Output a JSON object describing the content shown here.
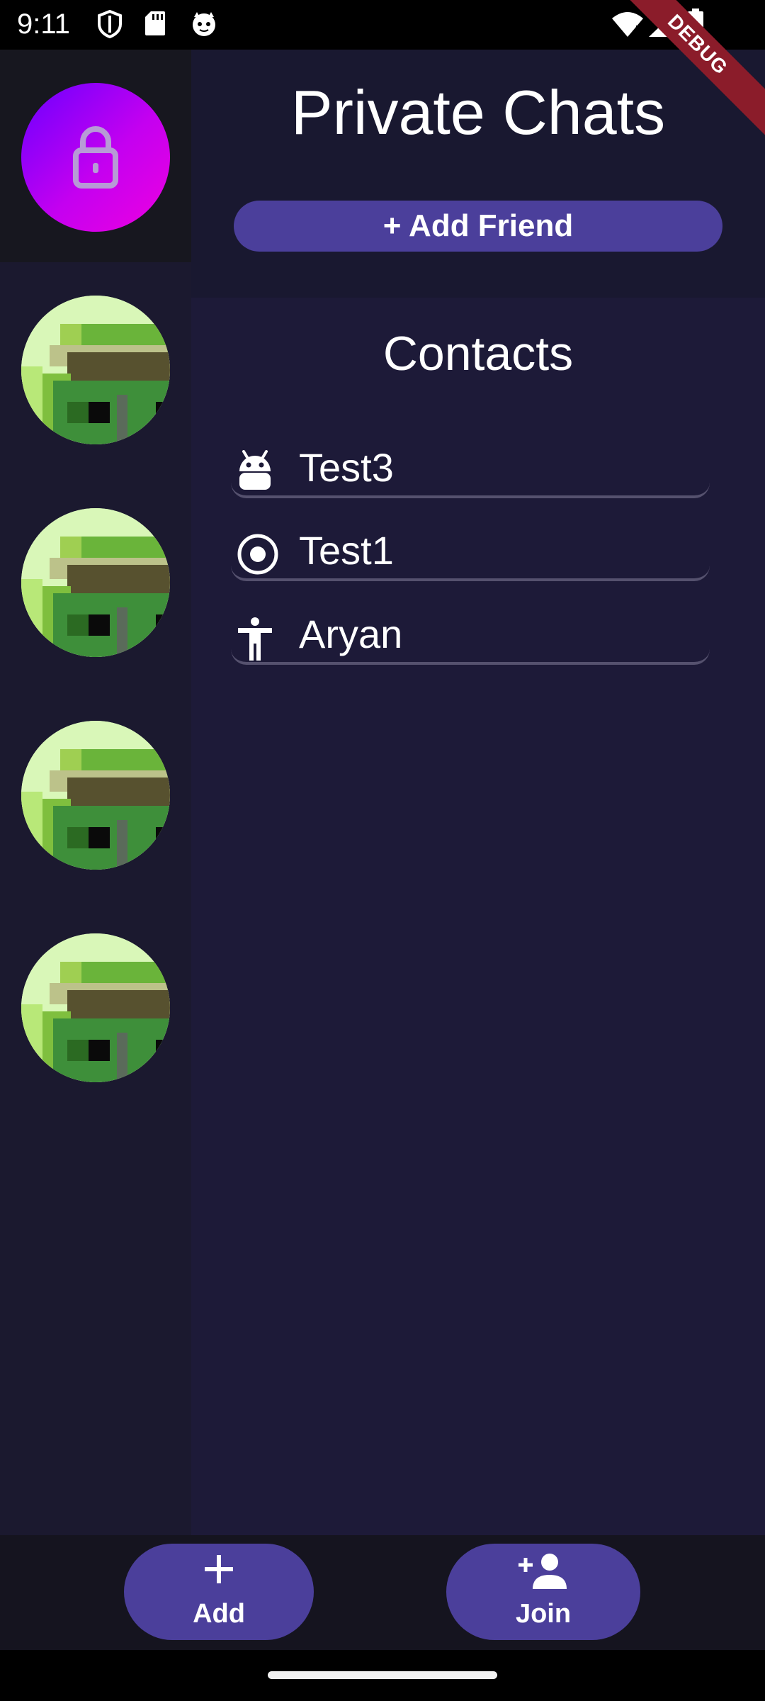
{
  "status_bar": {
    "time": "9:11",
    "left_icons": [
      "shield-icon",
      "sd-card-icon",
      "cat-face-icon"
    ],
    "right_icons": [
      "wifi-alert-icon",
      "cell-signal-icon",
      "battery-icon"
    ]
  },
  "debug_banner": "DEBUG",
  "header": {
    "title": "Private Chats",
    "add_friend_label": "+ Add Friend"
  },
  "sidebar": {
    "lock_icon": "lock-icon",
    "lock_gradient": [
      "#6a00ff",
      "#ee00e0"
    ],
    "avatar_count": 4
  },
  "contacts": {
    "heading": "Contacts",
    "items": [
      {
        "name": "Test3",
        "icon": "android-icon"
      },
      {
        "name": "Test1",
        "icon": "radio-target-icon"
      },
      {
        "name": "Aryan",
        "icon": "accessibility-icon"
      }
    ]
  },
  "bottom_bar": {
    "add_label": "Add",
    "add_icon": "plus-icon",
    "join_label": "Join",
    "join_icon": "person-add-icon"
  },
  "colors": {
    "background": "#1d1a38",
    "sidebar": "#1b192f",
    "accent_button": "#4b3f9b",
    "debug": "#8b1c2a"
  }
}
